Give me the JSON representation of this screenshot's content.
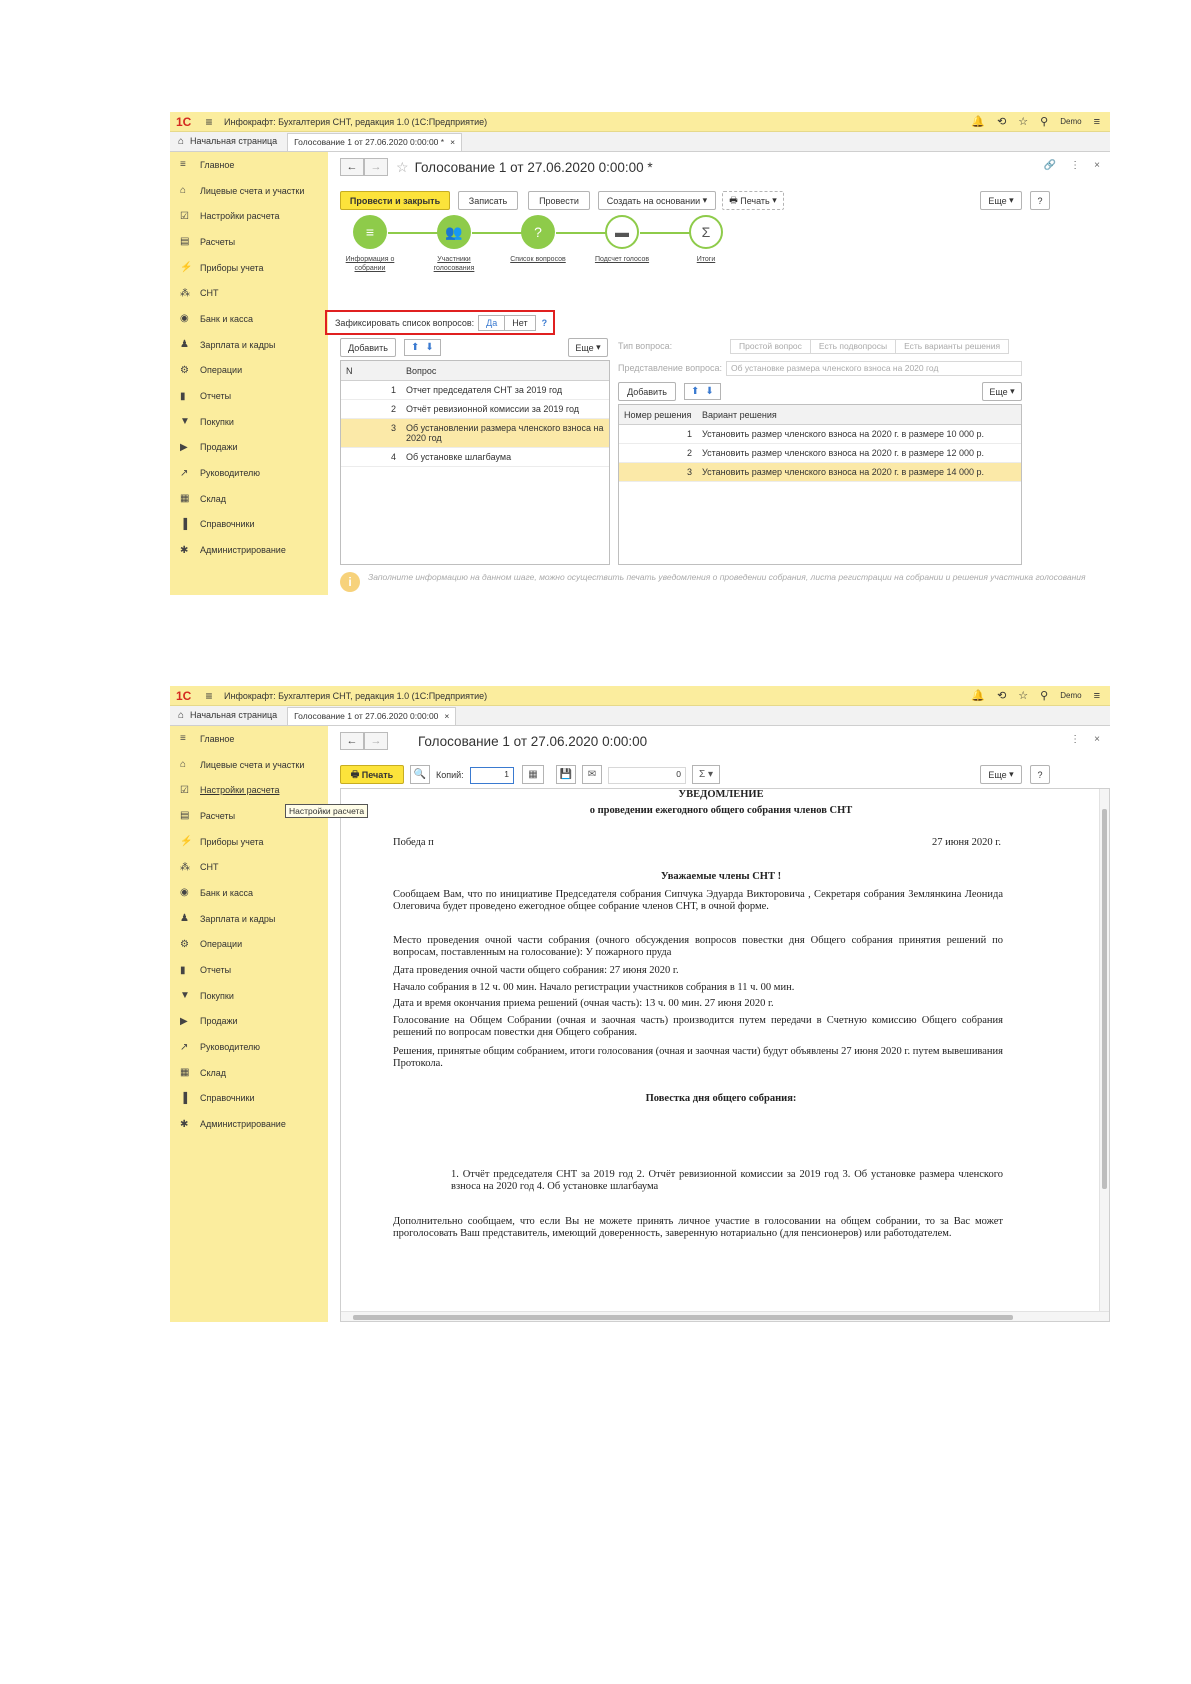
{
  "app": {
    "logo": "1С",
    "title": "Инфокрафт: Бухгалтерия СНТ, редакция 1.0  (1С:Предприятие)",
    "user": "Demo"
  },
  "tabs": {
    "home": "Начальная страница",
    "doc1": "Голосование 1 от 27.06.2020 0:00:00 *",
    "doc2": "Голосование 1 от 27.06.2020 0:00:00",
    "close": "×"
  },
  "sidebar": {
    "items": [
      {
        "label": "Главное",
        "icon": "≡"
      },
      {
        "label": "Лицевые счета и участки",
        "icon": "⌂"
      },
      {
        "label": "Настройки расчета",
        "icon": "☑"
      },
      {
        "label": "Расчеты",
        "icon": "▤"
      },
      {
        "label": "Приборы учета",
        "icon": "⚡"
      },
      {
        "label": "СНТ",
        "icon": "⁂"
      },
      {
        "label": "Банк и касса",
        "icon": "◉"
      },
      {
        "label": "Зарплата и кадры",
        "icon": "♟"
      },
      {
        "label": "Операции",
        "icon": "⚙"
      },
      {
        "label": "Отчеты",
        "icon": "▮"
      },
      {
        "label": "Покупки",
        "icon": "▼"
      },
      {
        "label": "Продажи",
        "icon": "▶"
      },
      {
        "label": "Руководителю",
        "icon": "↗"
      },
      {
        "label": "Склад",
        "icon": "▦"
      },
      {
        "label": "Справочники",
        "icon": "▐"
      },
      {
        "label": "Администрирование",
        "icon": "✱"
      }
    ],
    "tooltip": "Настройки расчета"
  },
  "screen1": {
    "title": "Голосование 1 от 27.06.2020 0:00:00 *",
    "buttons": {
      "post_close": "Провести и закрыть",
      "write": "Записать",
      "post": "Провести",
      "create_basis": "Создать на основании",
      "print": "Печать",
      "more": "Еще",
      "help": "?"
    },
    "steps": [
      {
        "label": "Информация о собрании",
        "icon": "≡"
      },
      {
        "label": "Участники голосования",
        "icon": "👥"
      },
      {
        "label": "Список вопросов",
        "icon": "?"
      },
      {
        "label": "Подсчет голосов",
        "icon": "▬"
      },
      {
        "label": "Итоги",
        "icon": "Σ"
      }
    ],
    "fix_list_label": "Зафиксировать список вопросов:",
    "yes": "Да",
    "no": "Нет",
    "q_mark": "?",
    "left_table": {
      "add": "Добавить",
      "more": "Еще",
      "headers": [
        "N",
        "Вопрос"
      ],
      "rows": [
        {
          "n": "1",
          "q": "Отчет председателя СНТ за 2019 год"
        },
        {
          "n": "2",
          "q": "Отчёт ревизионной комиссии за 2019 год"
        },
        {
          "n": "3",
          "q": "Об установлении размера членского взноса на 2020 год"
        },
        {
          "n": "4",
          "q": "Об установке шлагбаума"
        }
      ]
    },
    "right_panel": {
      "type_label": "Тип вопроса:",
      "types": [
        "Простой вопрос",
        "Есть подвопросы",
        "Есть варианты решения"
      ],
      "repr_label": "Представление вопроса:",
      "repr_value": "Об установке размера членского взноса на 2020 год",
      "add": "Добавить",
      "more": "Еще",
      "headers": [
        "Номер решения",
        "Вариант решения"
      ],
      "rows": [
        {
          "n": "1",
          "v": "Установить размер членского взноса на 2020 г. в размере 10 000 р."
        },
        {
          "n": "2",
          "v": "Установить размер членского взноса на 2020 г. в размере 12 000 р."
        },
        {
          "n": "3",
          "v": "Установить размер членского взноса на 2020 г. в размере 14 000 р."
        }
      ]
    },
    "hint": "Заполните информацию на данном шаге, можно осуществить печать уведомления о проведении собрания, листа регистрации на собрании и решения участника голосования"
  },
  "screen2": {
    "title": "Голосование 1 от 27.06.2020 0:00:00",
    "print": "Печать",
    "copies_label": "Копий:",
    "copies": "1",
    "sum_value": "0",
    "sigma": "Σ",
    "more": "Еще",
    "help": "?",
    "doc": {
      "h1": "УВЕДОМЛЕНИЕ",
      "h2": "о проведении ежегодного общего собрания членов СНТ",
      "place": "Победа п",
      "date": "27 июня 2020 г.",
      "greeting": "Уважаемые члены СНТ !",
      "p1": "Сообщаем Вам, что по инициативе Председателя собрания Сипчука Эдуарда Викторовича , Секретаря собрания Землянкина Леонида Олеговича будет проведено ежегодное общее собрание членов СНТ, в очной форме.",
      "p2": "Место проведения очной части собрания (очного обсуждения вопросов повестки дня Общего собрания принятия решений по вопросам, поставленным на голосование): У пожарного пруда",
      "p3": "Дата проведения очной части общего собрания: 27 июня 2020 г.",
      "p4": "Начало собрания в 12 ч. 00 мин. Начало регистрации участников собрания в 11 ч. 00 мин.",
      "p5": "Дата и время окончания приема решений (очная часть): 13 ч. 00 мин. 27 июня 2020 г.",
      "p6": "Голосование на Общем Собрании (очная и заочная часть) производится путем передачи в Счетную комиссию Общего собрания решений по вопросам повестки дня Общего собрания.",
      "p7": "Решения, принятые общим собранием, итоги голосования (очная и заочная части) будут объявлены 27 июня 2020 г. путем вывешивания Протокола.",
      "agenda_title": "Повестка дня общего собрания:",
      "agenda": "1. Отчёт председателя СНТ за 2019 год 2. Отчёт ревизионной комиссии за 2019 год 3. Об установке размера членского взноса на 2020 год 4. Об установке шлагбаума",
      "p8": "Дополнительно сообщаем, что если Вы не можете принять личное участие в голосовании на общем собрании, то за Вас может проголосовать Ваш представитель, имеющий доверенность, заверенную нотариально (для пенсионеров) или работодателем."
    }
  },
  "colors": {
    "sidebar": "#fbed9e",
    "accent": "#fce33b",
    "step_green": "#8ecb4a",
    "highlight": "#e02020",
    "selected_row": "#fbe9a8"
  }
}
